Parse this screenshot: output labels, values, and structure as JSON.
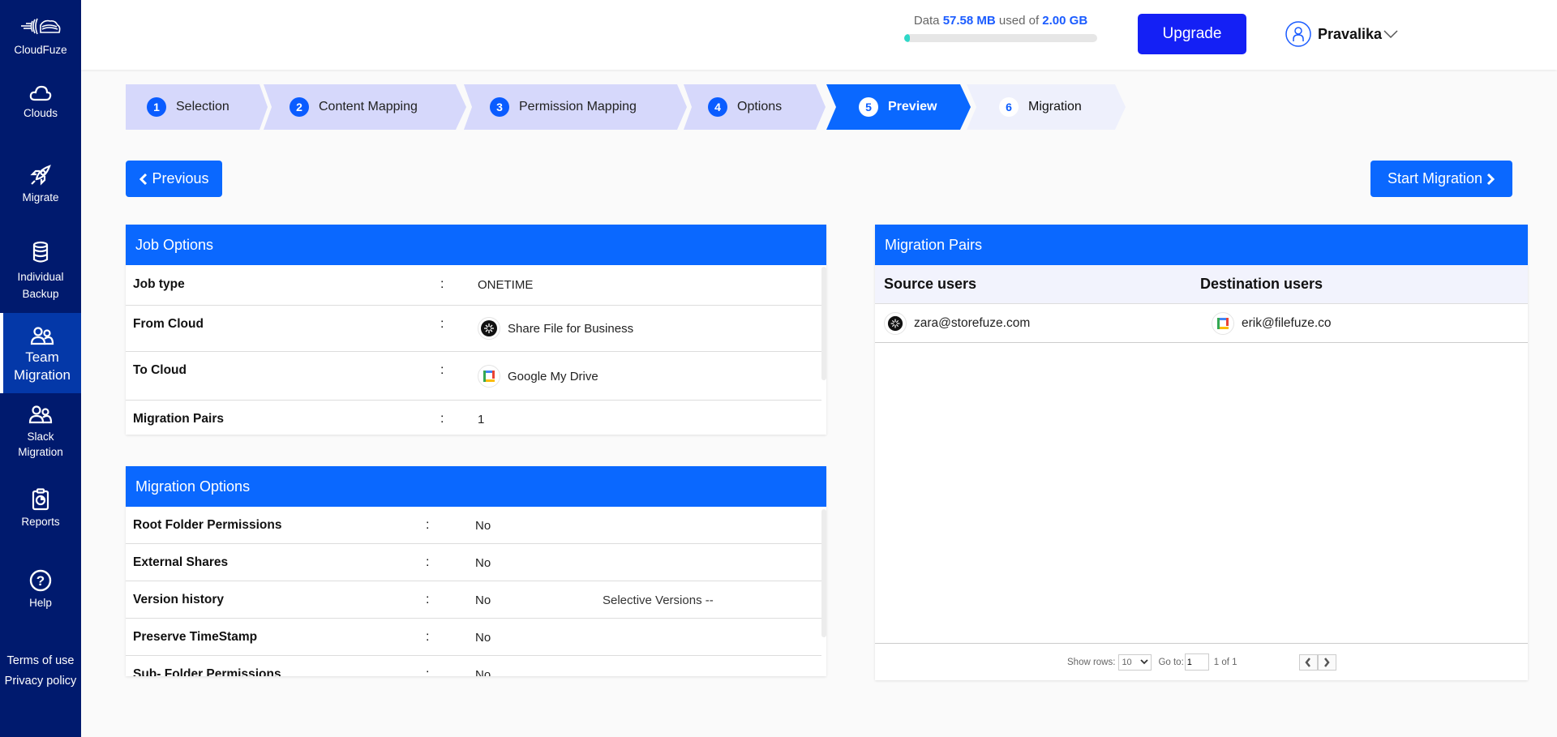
{
  "sidebar": {
    "brand": "CloudFuze",
    "items": [
      {
        "label": "Clouds",
        "icon": "cloud-icon"
      },
      {
        "label": "Migrate",
        "icon": "rocket-icon"
      },
      {
        "label": "Individual Backup",
        "label_line1": "Individual",
        "label_line2": "Backup",
        "icon": "database-icon"
      },
      {
        "label": "Team Migration",
        "label_line1": "Team",
        "label_line2": "Migration",
        "icon": "users-icon",
        "active": true
      },
      {
        "label": "Slack Migration",
        "label_line1": "Slack",
        "label_line2": "Migration",
        "icon": "users-icon"
      },
      {
        "label": "Reports",
        "icon": "clipboard-icon"
      },
      {
        "label": "Help",
        "icon": "help-icon"
      }
    ],
    "links": {
      "terms": "Terms of use",
      "privacy": "Privacy policy"
    }
  },
  "header": {
    "storage": {
      "prefix": "Data",
      "used": "57.58 MB",
      "middle": "used of",
      "total": "2.00 GB",
      "used_fraction": 0.028
    },
    "upgrade_label": "Upgrade",
    "user_name": "Pravalika"
  },
  "stepper": {
    "steps": [
      {
        "num": "1",
        "label": "Selection",
        "state": "done"
      },
      {
        "num": "2",
        "label": "Content Mapping",
        "state": "done"
      },
      {
        "num": "3",
        "label": "Permission Mapping",
        "state": "done"
      },
      {
        "num": "4",
        "label": "Options",
        "state": "done"
      },
      {
        "num": "5",
        "label": "Preview",
        "state": "active"
      },
      {
        "num": "6",
        "label": "Migration",
        "state": "future"
      }
    ]
  },
  "actions": {
    "previous_label": "Previous",
    "start_label": "Start Migration"
  },
  "job_options": {
    "title": "Job Options",
    "rows": [
      {
        "key": "Job type",
        "sep": ":",
        "value": "ONETIME"
      },
      {
        "key": "From Cloud",
        "sep": ":",
        "value": "Share File for Business",
        "icon": "sharefile-icon"
      },
      {
        "key": "To Cloud",
        "sep": ":",
        "value": "Google My Drive",
        "icon": "google-drive-icon"
      },
      {
        "key": "Migration Pairs",
        "sep": ":",
        "value": "1"
      }
    ]
  },
  "migration_options": {
    "title": "Migration Options",
    "rows": [
      {
        "key": "Root Folder Permissions",
        "sep": ":",
        "value": "No"
      },
      {
        "key": "External Shares",
        "sep": ":",
        "value": "No"
      },
      {
        "key": "Version history",
        "sep": ":",
        "value": "No",
        "extra": "Selective Versions --"
      },
      {
        "key": "Preserve TimeStamp",
        "sep": ":",
        "value": "No"
      },
      {
        "key": "Sub- Folder Permissions",
        "sep": ":",
        "value": "No"
      }
    ]
  },
  "migration_pairs": {
    "title": "Migration Pairs",
    "columns": [
      "Source users",
      "Destination users"
    ],
    "rows": [
      {
        "source": "zara@storefuze.com",
        "destination": "erik@filefuze.co"
      }
    ],
    "footer": {
      "show_rows_label": "Show rows:",
      "rows_value": "10",
      "goto_label": "Go to:",
      "goto_value": "1",
      "page_info": "1 of 1"
    }
  }
}
